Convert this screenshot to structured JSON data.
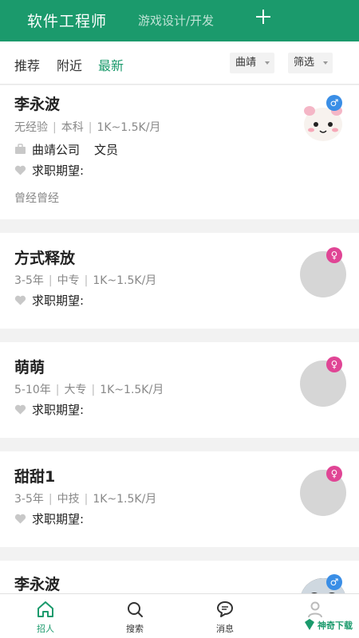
{
  "header": {
    "title": "软件工程师",
    "subtitle": "游戏设计/开发",
    "add_icon": "plus-icon"
  },
  "filters": {
    "tabs": [
      {
        "label": "推荐",
        "active": false
      },
      {
        "label": "附近",
        "active": false
      },
      {
        "label": "最新",
        "active": true
      }
    ],
    "city": "曲靖",
    "filter": "筛选"
  },
  "candidates": [
    {
      "name": "李永波",
      "experience": "无经验",
      "education": "本科",
      "salary": "1K~1.5K/月",
      "company": "曲靖公司",
      "position": "文员",
      "expectation_label": "求职期望:",
      "note": "曾经曾经",
      "gender": "male",
      "avatar": "cartoon-avatar"
    },
    {
      "name": "方式释放",
      "experience": "3-5年",
      "education": "中专",
      "salary": "1K~1.5K/月",
      "expectation_label": "求职期望:",
      "gender": "female",
      "avatar": "default-avatar"
    },
    {
      "name": "萌萌",
      "experience": "5-10年",
      "education": "大专",
      "salary": "1K~1.5K/月",
      "expectation_label": "求职期望:",
      "gender": "female",
      "avatar": "default-avatar"
    },
    {
      "name": "甜甜1",
      "experience": "3-5年",
      "education": "中技",
      "salary": "1K~1.5K/月",
      "expectation_label": "求职期望:",
      "gender": "female",
      "avatar": "default-avatar"
    },
    {
      "name": "李永波",
      "gender": "male",
      "avatar": "photo-avatar"
    }
  ],
  "tabbar": [
    {
      "label": "招人",
      "icon": "home-icon",
      "active": true
    },
    {
      "label": "搜索",
      "icon": "search-icon",
      "active": false
    },
    {
      "label": "消息",
      "icon": "message-icon",
      "active": false
    },
    {
      "label": "",
      "icon": "profile-icon",
      "active": false
    }
  ],
  "watermark": "神奇下载",
  "colors": {
    "accent": "#1b9a6c",
    "male_badge": "#3a8ee6",
    "female_badge": "#e04595"
  }
}
